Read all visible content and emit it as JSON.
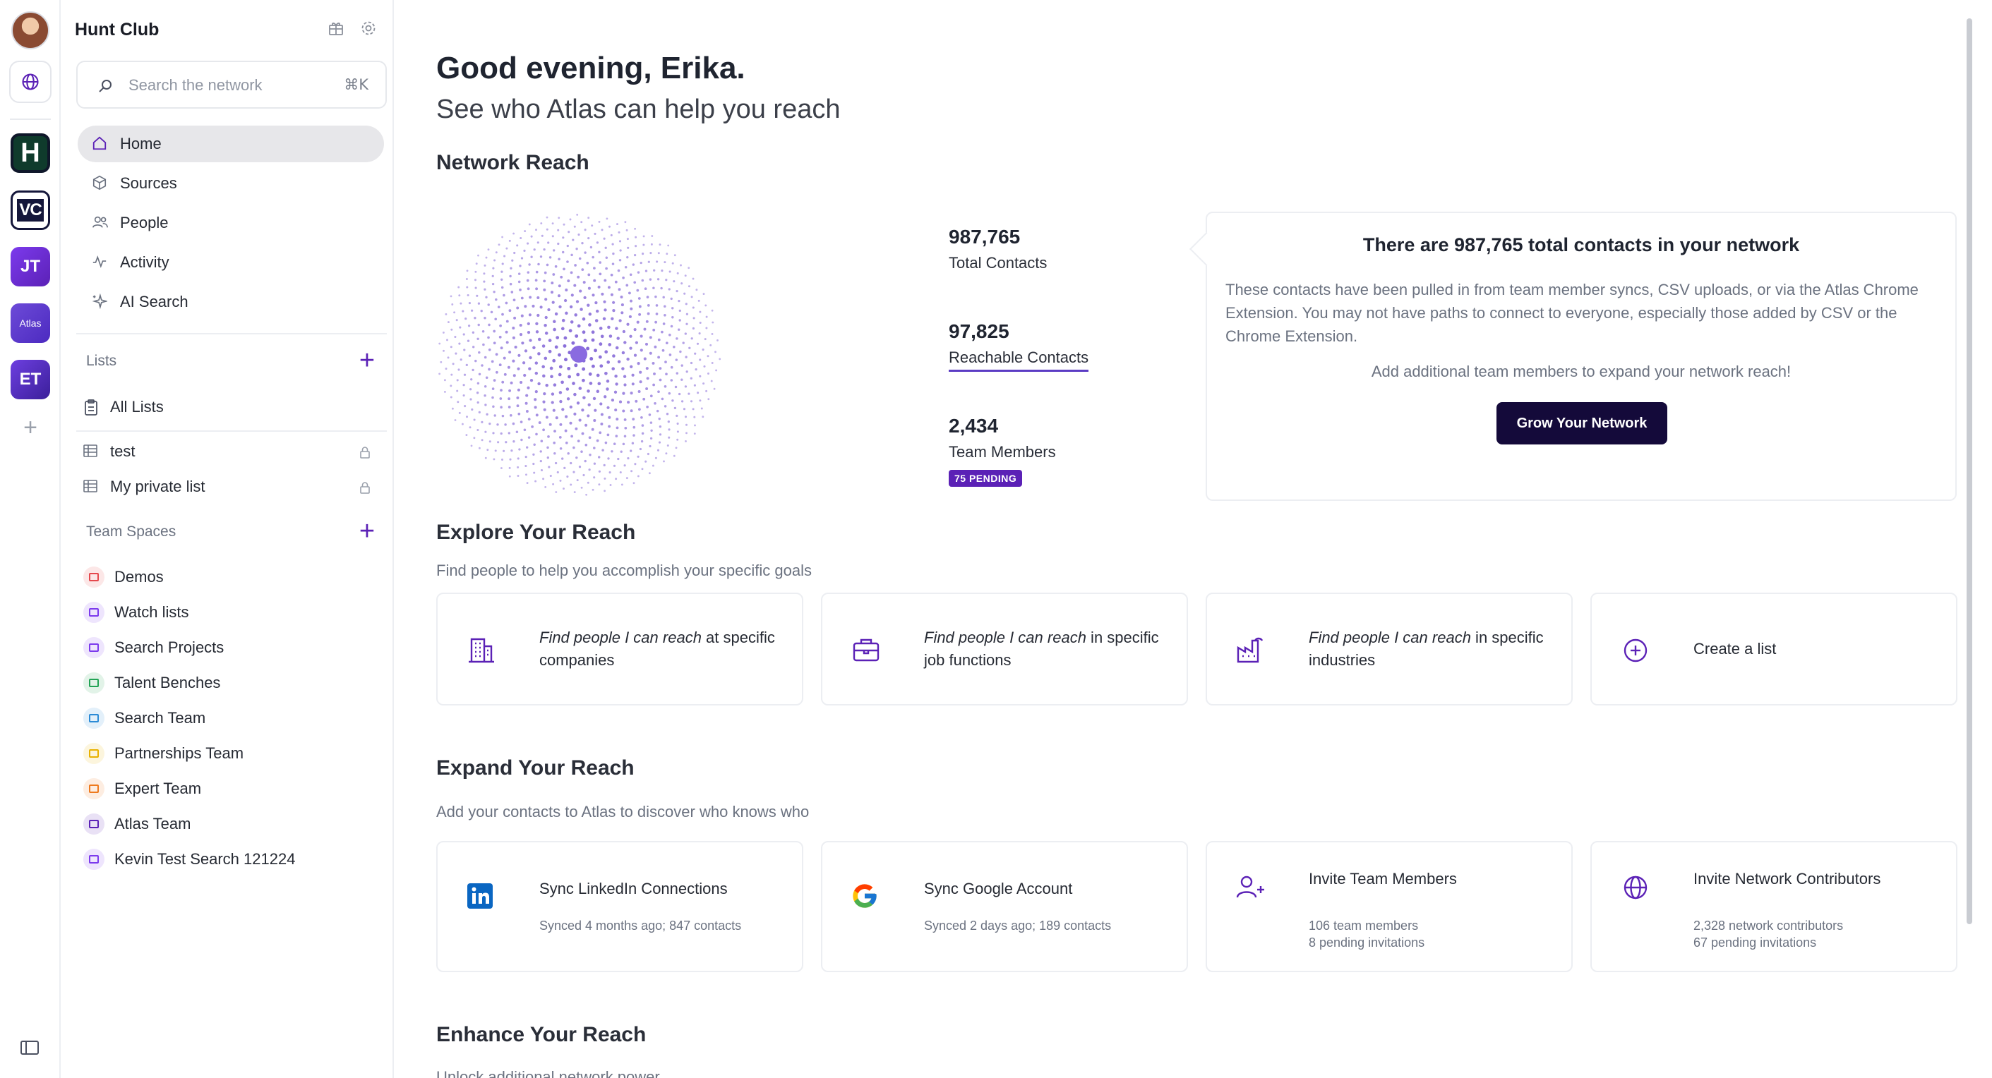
{
  "app": {
    "name": "Hunt Club"
  },
  "rail": {
    "workspaces": [
      "H",
      "VC",
      "JT",
      "Atlas",
      "ET"
    ]
  },
  "search": {
    "placeholder": "Search the network",
    "shortcut": "⌘K"
  },
  "nav": [
    {
      "label": "Home",
      "icon": "home-icon",
      "active": true
    },
    {
      "label": "Sources",
      "icon": "cube-icon"
    },
    {
      "label": "People",
      "icon": "people-icon"
    },
    {
      "label": "Activity",
      "icon": "activity-icon"
    },
    {
      "label": "AI Search",
      "icon": "sparkle-icon"
    }
  ],
  "lists": {
    "title": "Lists",
    "all_label": "All Lists",
    "items": [
      {
        "label": "test",
        "locked": true
      },
      {
        "label": "My private list",
        "locked": true
      }
    ]
  },
  "team_spaces": {
    "title": "Team Spaces",
    "items": [
      {
        "label": "Demos",
        "color": "#e5484d"
      },
      {
        "label": "Watch lists",
        "color": "#7c3aed"
      },
      {
        "label": "Search Projects",
        "color": "#7c3aed"
      },
      {
        "label": "Talent Benches",
        "color": "#22a355"
      },
      {
        "label": "Search Team",
        "color": "#2b8bd6"
      },
      {
        "label": "Partnerships Team",
        "color": "#e8b100"
      },
      {
        "label": "Expert Team",
        "color": "#ee7a1e"
      },
      {
        "label": "Atlas Team",
        "color": "#5b21b6"
      },
      {
        "label": "Kevin Test Search 121224",
        "color": "#7c3aed"
      }
    ]
  },
  "main": {
    "greeting": "Good evening, Erika.",
    "subtitle": "See who Atlas can help you reach",
    "network_reach": {
      "title": "Network Reach",
      "stats": [
        {
          "value": "987,765",
          "label": "Total Contacts"
        },
        {
          "value": "97,825",
          "label": "Reachable Contacts"
        },
        {
          "value": "2,434",
          "label": "Team Members",
          "badge": "75 PENDING"
        }
      ],
      "info_title": "There are 987,765 total contacts in your network",
      "info_body": "These contacts have been pulled in from team member syncs, CSV uploads, or via the Atlas Chrome Extension. You may not have paths to connect to everyone, especially those added by CSV or the Chrome Extension.",
      "info_cta_text": "Add additional team members to expand your network reach!",
      "button": "Grow Your Network"
    },
    "explore": {
      "title": "Explore Your Reach",
      "desc": "Find people to help you accomplish your specific goals",
      "cards": [
        {
          "em": "Find people I can reach",
          "rest": " at specific companies",
          "icon": "building-icon"
        },
        {
          "em": "Find people I can reach",
          "rest": " in specific job functions",
          "icon": "briefcase-icon"
        },
        {
          "em": "Find people I can reach",
          "rest": " in specific industries",
          "icon": "factory-icon"
        },
        {
          "em": "",
          "rest": "Create a list",
          "icon": "plus-circle-icon"
        }
      ]
    },
    "expand": {
      "title": "Expand Your Reach",
      "desc": "Add your contacts to Atlas to discover who knows who",
      "cards": [
        {
          "title": "Sync LinkedIn Connections",
          "meta": [
            "Synced 4 months ago; 847 contacts"
          ],
          "icon": "linkedin-icon"
        },
        {
          "title": "Sync Google Account",
          "meta": [
            "Synced 2 days ago; 189 contacts"
          ],
          "icon": "google-icon"
        },
        {
          "title": "Invite Team Members",
          "meta": [
            "106 team members",
            "8 pending invitations"
          ],
          "icon": "user-plus-icon"
        },
        {
          "title": "Invite Network Contributors",
          "meta": [
            "2,328 network contributors",
            "67 pending invitations"
          ],
          "icon": "globe-icon"
        }
      ]
    },
    "enhance": {
      "title": "Enhance Your Reach",
      "desc": "Unlock additional network power"
    }
  }
}
